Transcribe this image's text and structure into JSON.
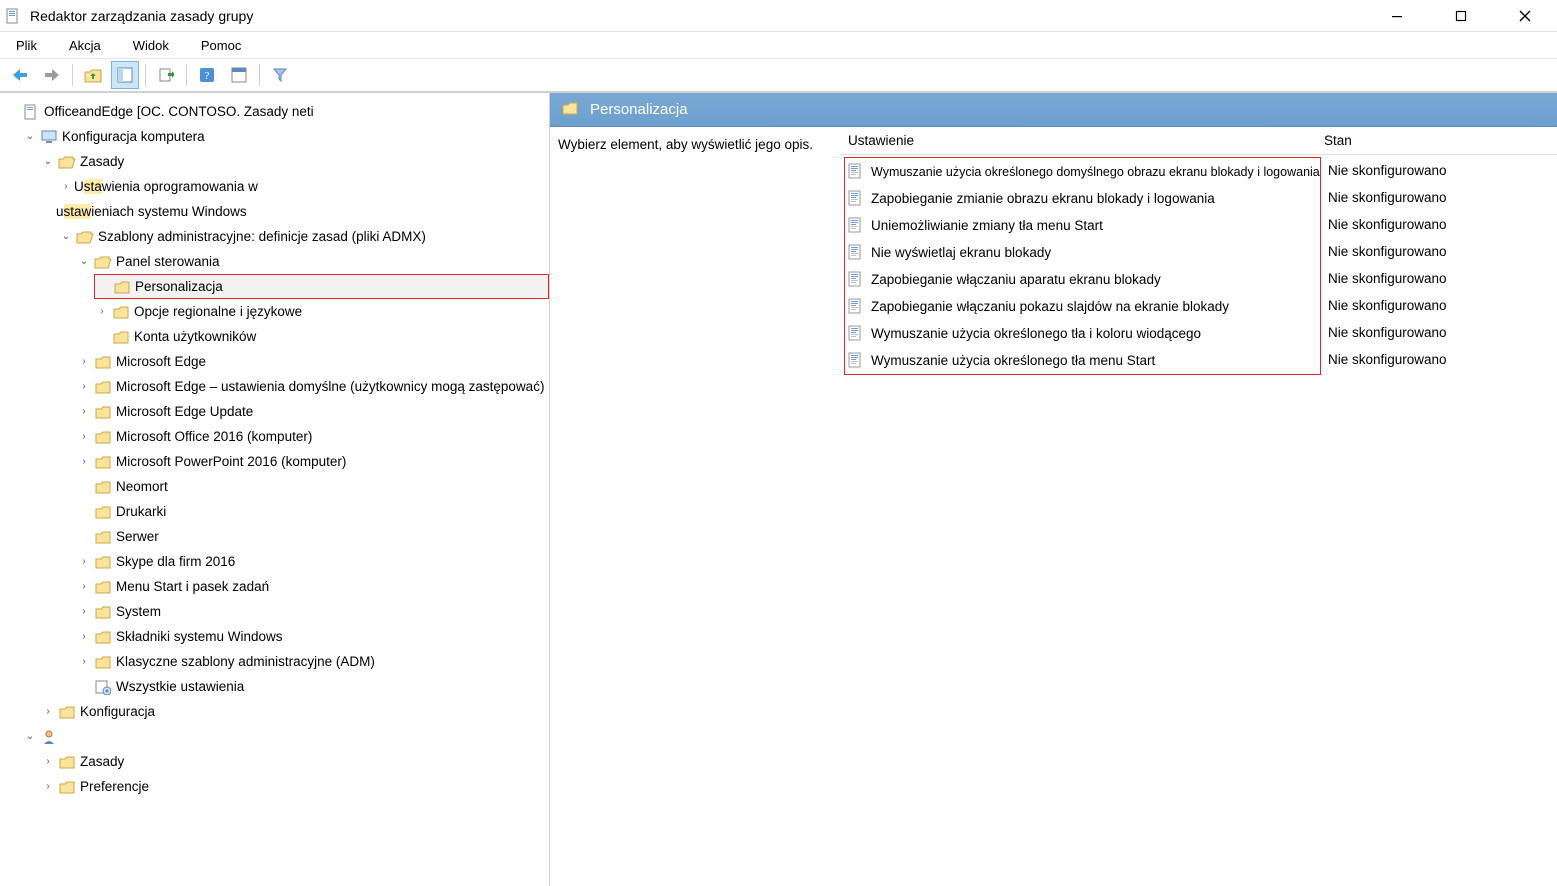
{
  "window": {
    "title": "Redaktor zarządzania zasady grupy"
  },
  "menu": {
    "file": "Plik",
    "action": "Akcja",
    "view": "Widok",
    "help": "Pomoc"
  },
  "tree": {
    "root": "OfficeandEdge [OC. CONTOSO. Zasady neti",
    "computer_config": "Konfiguracja komputera",
    "policies": "Zasady",
    "software_settings_1": "Ustawienia oprogramowania w",
    "software_settings_2": "ustawieniach systemu Windows",
    "admin_templates": "Szablony administracyjne: definicje zasad (pliki ADMX)",
    "control_panel": "Panel sterowania",
    "personalization": "Personalizacja",
    "regional_lang": "Opcje regionalne i językowe",
    "user_accounts": "Konta użytkowników",
    "edge": "Microsoft Edge",
    "edge_default": "Microsoft Edge – ustawienia domyślne (użytkownicy mogą zastępować)",
    "edge_update": "Microsoft Edge Update",
    "office_2016": "Microsoft Office 2016 (komputer)",
    "ppt_2016": "Microsoft PowerPoint 2016 (komputer)",
    "neomort": "Neomort",
    "printers": "Drukarki",
    "server": "Serwer",
    "skype": "Skype dla firm 2016",
    "start_taskbar": "Menu Start i pasek zadań",
    "system": "System",
    "win_components": "Składniki systemu Windows",
    "classic_adm": "Klasyczne szablony administracyjne (ADM)",
    "all_settings": "Wszystkie ustawienia",
    "configuration": "Konfiguracja",
    "policies2": "Zasady",
    "preferences": "Preferencje"
  },
  "details": {
    "title": "Personalizacja",
    "hint": "Wybierz element, aby wyświetlić jego opis.",
    "col_setting": "Ustawienie",
    "col_state": "Stan",
    "settings": [
      "Wymuszanie użycia określonego domyślnego obrazu ekranu blokady i logowania",
      "Zapobieganie zmianie obrazu ekranu blokady i logowania",
      "Uniemożliwianie zmiany tła menu Start",
      "Nie wyświetlaj ekranu blokady",
      "Zapobieganie włączaniu aparatu ekranu blokady",
      "Zapobieganie włączaniu pokazu slajdów na ekranie blokady",
      "Wymuszanie użycia określonego tła i koloru wiodącego",
      "Wymuszanie użycia określonego tła menu Start"
    ],
    "state_value": "Nie skonfigurowano"
  }
}
